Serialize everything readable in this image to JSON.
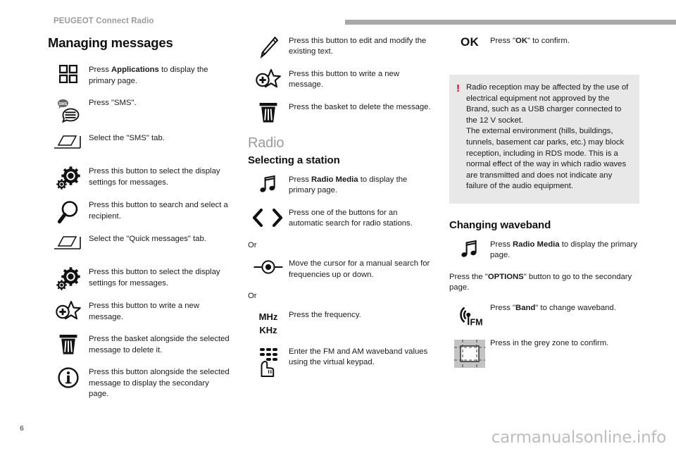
{
  "header": {
    "title": "PEUGEOT Connect Radio",
    "accent_bar_color": "#a8a8a8"
  },
  "footer": {
    "page_number": "6",
    "watermark": "carmanualsonline.info"
  },
  "colors": {
    "warning_background": "#e8e8e8",
    "warning_mark": "#e2001a",
    "grey_heading": "#9b9b9b",
    "body_text": "#1a1a1a"
  },
  "column1": {
    "section_title": "Managing messages",
    "rows": [
      {
        "icon": "applications-grid-icon",
        "text_html": "Press <b>Applications</b> to display the primary page."
      },
      {
        "icon": "sms-bubble-icon",
        "text_html": "Press \"SMS\"."
      },
      {
        "icon": "tab-select-icon",
        "text_html": "Select the \"SMS\" tab."
      },
      {
        "icon": "settings-gears-icon",
        "text_html": "Press this button to select the display settings for messages."
      },
      {
        "icon": "magnifier-search-icon",
        "text_html": "Press this button to search and select a recipient."
      },
      {
        "icon": "tab-select-icon",
        "text_html": "Select the \"Quick messages\" tab."
      },
      {
        "icon": "settings-gears-icon",
        "text_html": "Press this button to select the display settings for messages."
      },
      {
        "icon": "new-message-star-icon",
        "text_html": "Press this button to write a new message."
      },
      {
        "icon": "trash-basket-icon",
        "text_html": "Press the basket alongside the selected message to delete it."
      },
      {
        "icon": "info-circle-icon",
        "text_html": "Press this button alongside the selected message to display the secondary page."
      }
    ]
  },
  "column2": {
    "top_rows": [
      {
        "icon": "pencil-edit-icon",
        "text_html": "Press this button to edit and modify the existing text."
      },
      {
        "icon": "new-message-star-icon",
        "text_html": "Press this button to write a new message."
      },
      {
        "icon": "trash-basket-icon",
        "text_html": "Press the basket to delete the message."
      }
    ],
    "radio_heading": "Radio",
    "selecting_heading": "Selecting a station",
    "radio_rows": [
      {
        "icon": "music-note-icon",
        "text_html": "Press <b>Radio Media</b> to display the primary page."
      },
      {
        "icon": "prev-next-arrows-icon",
        "text_html": "Press one of the buttons for an automatic search for radio stations."
      }
    ],
    "or_label_1": "Or",
    "manual_row": {
      "icon": "rotary-knob-icon",
      "text_html": "Move the cursor for a manual search for frequencies up or down."
    },
    "or_label_2": "Or",
    "frequency_row": {
      "icon": "mhz-khz-glyph",
      "glyph_line1": "MHz",
      "glyph_line2": "KHz",
      "text_html": "Press the frequency."
    },
    "keypad_row": {
      "icon": "virtual-keypad-icon",
      "text_html": "Enter the FM and AM waveband values using the virtual keypad."
    }
  },
  "column3": {
    "ok_row": {
      "icon": "ok-glyph",
      "glyph": "OK",
      "text_html": "Press \"<b>OK</b>\" to confirm."
    },
    "warning": {
      "mark": "!",
      "text": "Radio reception may be affected by the use of electrical equipment not approved by the Brand, such as a USB charger connected to the 12 V socket.\nThe external environment (hills, buildings, tunnels, basement car parks, etc.) may block reception, including in RDS mode. This is a normal effect of the way in which radio waves are transmitted and does not indicate any failure of the audio equipment."
    },
    "waveband_heading": "Changing waveband",
    "rows_after_heading": [
      {
        "icon": "music-note-icon",
        "text_html": "Press <b>Radio Media</b> to display the primary page."
      }
    ],
    "options_paragraph_html": "Press the \"<b>OPTIONS</b>\" button to go to the secondary page.",
    "rows_tail": [
      {
        "icon": "fm-antenna-icon",
        "text_html": "Press \"<b>Band</b>\" to change waveband."
      },
      {
        "icon": "grey-zone-icon",
        "text_html": "Press in the grey zone to confirm."
      }
    ]
  }
}
